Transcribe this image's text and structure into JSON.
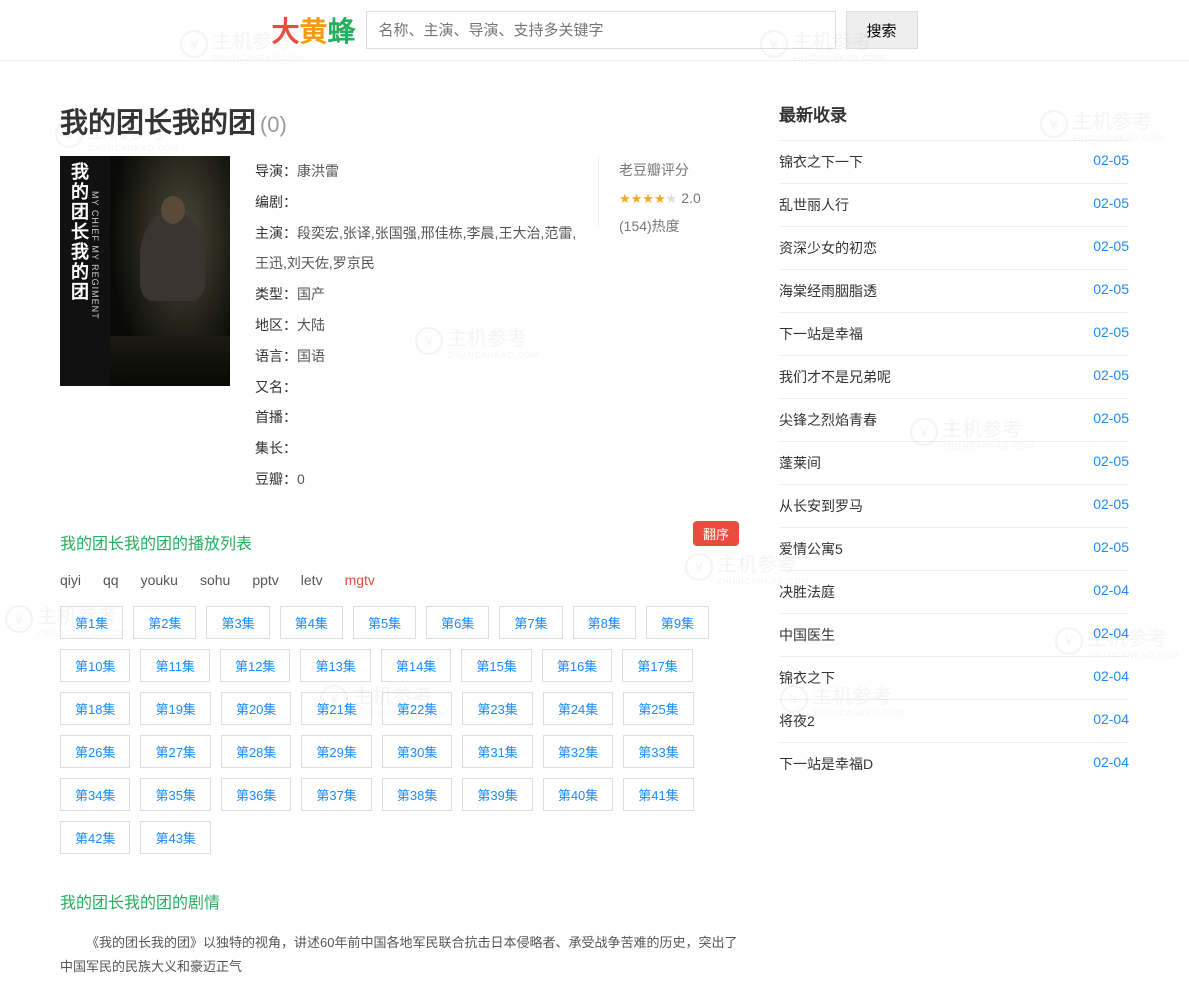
{
  "logo": {
    "c1": "大",
    "c2": "黄",
    "c3": "蜂"
  },
  "search": {
    "placeholder": "名称、主演、导演、支持多关键字",
    "button": "搜索"
  },
  "title": "我的团长我的团",
  "title_count": "(0)",
  "poster": {
    "title_cn": "我的团长我的团",
    "title_en": "MY CHIEF MY REGIMENT"
  },
  "meta": {
    "director_l": "导演：",
    "director": "康洪雷",
    "writer_l": "编剧：",
    "writer": "",
    "cast_l": "主演：",
    "cast": "段奕宏,张译,张国强,邢佳栋,李晨,王大治,范雷,王迅,刘天佐,罗京民",
    "type_l": "类型：",
    "type": "国产",
    "region_l": "地区：",
    "region": "大陆",
    "lang_l": "语言：",
    "lang": "国语",
    "aka_l": "又名：",
    "aka": "",
    "premiere_l": "首播：",
    "premiere": "",
    "length_l": "集长：",
    "length": "",
    "douban_l": "豆瓣：",
    "douban": "0"
  },
  "rating": {
    "label": "老豆瓣评分",
    "score": "2.0",
    "heat": "(154)热度"
  },
  "playlist_title": "我的团长我的团的播放列表",
  "flip": "翻序",
  "sources": [
    "qiyi",
    "qq",
    "youku",
    "sohu",
    "pptv",
    "letv",
    "mgtv"
  ],
  "active_source": 6,
  "episodes": [
    "第1集",
    "第2集",
    "第3集",
    "第4集",
    "第5集",
    "第6集",
    "第7集",
    "第8集",
    "第9集",
    "第10集",
    "第11集",
    "第12集",
    "第13集",
    "第14集",
    "第15集",
    "第16集",
    "第17集",
    "第18集",
    "第19集",
    "第20集",
    "第21集",
    "第22集",
    "第23集",
    "第24集",
    "第25集",
    "第26集",
    "第27集",
    "第28集",
    "第29集",
    "第30集",
    "第31集",
    "第32集",
    "第33集",
    "第34集",
    "第35集",
    "第36集",
    "第37集",
    "第38集",
    "第39集",
    "第40集",
    "第41集",
    "第42集",
    "第43集"
  ],
  "plot_title": "我的团长我的团的剧情",
  "plot": "《我的团长我的团》以独特的视角，讲述60年前中国各地军民联合抗击日本侵略者、承受战争苦难的历史，突出了中国军民的民族大义和豪迈正气",
  "side_title": "最新收录",
  "recent": [
    {
      "name": "锦衣之下一下",
      "date": "02-05"
    },
    {
      "name": "乱世丽人行",
      "date": "02-05"
    },
    {
      "name": "资深少女的初恋",
      "date": "02-05"
    },
    {
      "name": "海棠经雨胭脂透",
      "date": "02-05"
    },
    {
      "name": "下一站是幸福",
      "date": "02-05"
    },
    {
      "name": "我们才不是兄弟呢",
      "date": "02-05"
    },
    {
      "name": "尖锋之烈焰青春",
      "date": "02-05"
    },
    {
      "name": "蓬莱间",
      "date": "02-05"
    },
    {
      "name": "从长安到罗马",
      "date": "02-05"
    },
    {
      "name": "爱情公寓5",
      "date": "02-05"
    },
    {
      "name": "决胜法庭",
      "date": "02-04"
    },
    {
      "name": "中国医生",
      "date": "02-04"
    },
    {
      "name": "锦衣之下",
      "date": "02-04"
    },
    {
      "name": "将夜2",
      "date": "02-04"
    },
    {
      "name": "下一站是幸福D",
      "date": "02-04"
    }
  ],
  "watermark": {
    "text": "主机参考",
    "sub": "ZHUJICANKAO.COM",
    "icon": "¥"
  }
}
